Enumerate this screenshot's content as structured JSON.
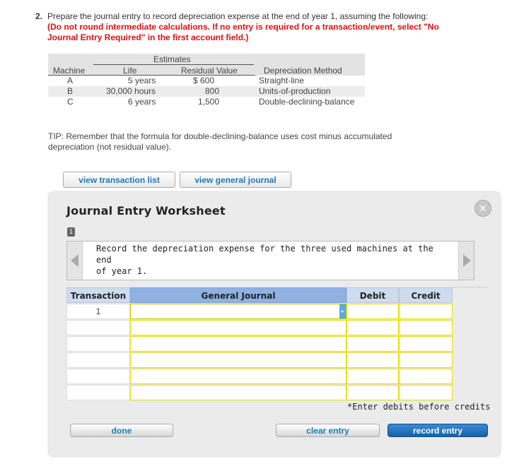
{
  "question": {
    "number": "2.",
    "text": "Prepare the journal entry to record depreciation expense at the end of year 1, assuming the following:",
    "note_line1": "(Do not round intermediate calculations. If no entry is required for a transaction/event, select \"No",
    "note_line2": "Journal Entry Required\" in the first account field.)"
  },
  "estimates": {
    "group_header": "Estimates",
    "headers": [
      "Machine",
      "Life",
      "Residual Value",
      "Depreciation Method"
    ],
    "rows": [
      {
        "machine": "A",
        "life": "5 years",
        "residual": "$  600",
        "method": "Straight-line"
      },
      {
        "machine": "B",
        "life": "30,000 hours",
        "residual": "800",
        "method": "Units-of-production"
      },
      {
        "machine": "C",
        "life": "6 years",
        "residual": "1,500",
        "method": "Double-declining-balance"
      }
    ]
  },
  "tip": {
    "line1": "TIP: Remember that the formula for double-declining-balance uses cost minus accumulated",
    "line2": "depreciation (not residual value)."
  },
  "buttons": {
    "view_transaction_list": "view transaction list",
    "view_general_journal": "view general journal",
    "done": "done",
    "clear_entry": "clear entry",
    "record_entry": "record entry"
  },
  "worksheet": {
    "title": "Journal Entry Worksheet",
    "close_icon": "close-icon",
    "step": "1",
    "instruction_line1": "Record the depreciation expense for the three used machines at the end",
    "instruction_line2": "of year 1.",
    "columns": [
      "Transaction",
      "General Journal",
      "Debit",
      "Credit"
    ],
    "rows": [
      {
        "transaction": "1",
        "account": "",
        "debit": "",
        "credit": ""
      },
      {
        "transaction": "",
        "account": "",
        "debit": "",
        "credit": ""
      },
      {
        "transaction": "",
        "account": "",
        "debit": "",
        "credit": ""
      },
      {
        "transaction": "",
        "account": "",
        "debit": "",
        "credit": ""
      },
      {
        "transaction": "",
        "account": "",
        "debit": "",
        "credit": ""
      },
      {
        "transaction": "",
        "account": "",
        "debit": "",
        "credit": ""
      }
    ],
    "enter_note": "*Enter debits before credits"
  },
  "colors": {
    "header_blue": "#8fb1e3",
    "yellow_border": "#e5dd00",
    "link_blue": "#1b7ab8",
    "warning_red": "#dd1111"
  }
}
